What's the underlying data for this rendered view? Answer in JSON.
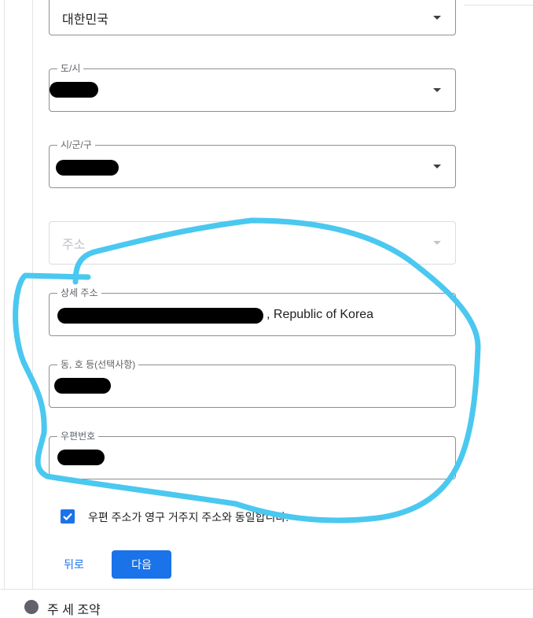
{
  "form": {
    "country": {
      "label": "",
      "value": "대한민국"
    },
    "province": {
      "label": "도/시",
      "value": ""
    },
    "city": {
      "label": "시/군/구",
      "value": ""
    },
    "address": {
      "placeholder": "주소"
    },
    "detail_address": {
      "label": "상세 주소",
      "value_suffix": ", Republic of Korea"
    },
    "unit": {
      "label": "동, 호 등(선택사항)",
      "value": ""
    },
    "postal_code": {
      "label": "우편번호",
      "value": ""
    },
    "same_address_checkbox": {
      "checked": true,
      "label": "우편 주소가 영구 거주지 주소와 동일합니다."
    }
  },
  "actions": {
    "back_label": "뒤로",
    "next_label": "다음"
  },
  "footer": {
    "text": "주 세 조약"
  },
  "colors": {
    "primary": "#1a73e8",
    "annotation": "#4ac8f0",
    "redaction": "#000000"
  }
}
